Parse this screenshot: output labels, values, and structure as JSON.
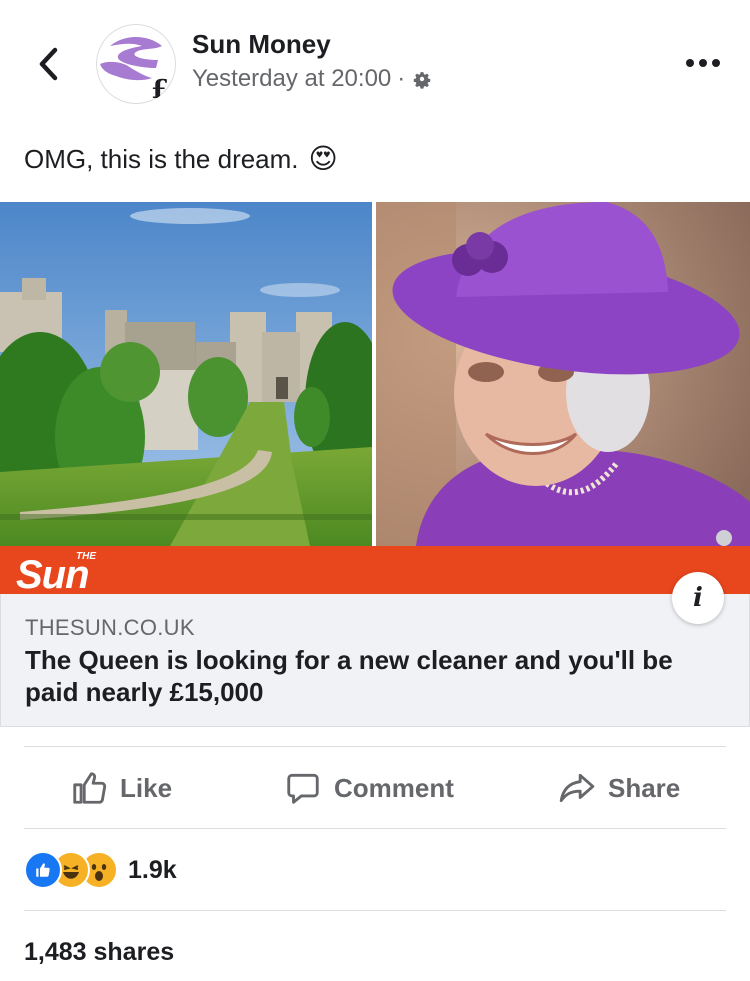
{
  "header": {
    "page_name": "Sun Money",
    "timestamp": "Yesterday at 20:00",
    "separator": "·",
    "avatar_symbol": "£",
    "icons": {
      "back": "chevron-left-icon",
      "privacy": "gear-icon",
      "more": "more-horizontal-icon"
    }
  },
  "post": {
    "text": "OMG, this is the dream.",
    "emoji": "😍"
  },
  "link_preview": {
    "brand_logo_text": "Sun",
    "brand_logo_small": "THE",
    "domain": "THESUN.CO.UK",
    "headline": "The Queen is looking for a new cleaner and you'll be paid nearly £15,000",
    "info_label": "i"
  },
  "actions": {
    "like": "Like",
    "comment": "Comment",
    "share": "Share"
  },
  "stats": {
    "reaction_count": "1.9k",
    "reactions": [
      "like",
      "haha",
      "wow"
    ],
    "shares": "1,483 shares"
  },
  "colors": {
    "sun_red": "#e8461d",
    "avatar_purple": "#a77bd1",
    "like_blue": "#1877f2",
    "text_primary": "#1c1e21",
    "text_secondary": "#65676b",
    "card_bg": "#f0f2f5"
  }
}
